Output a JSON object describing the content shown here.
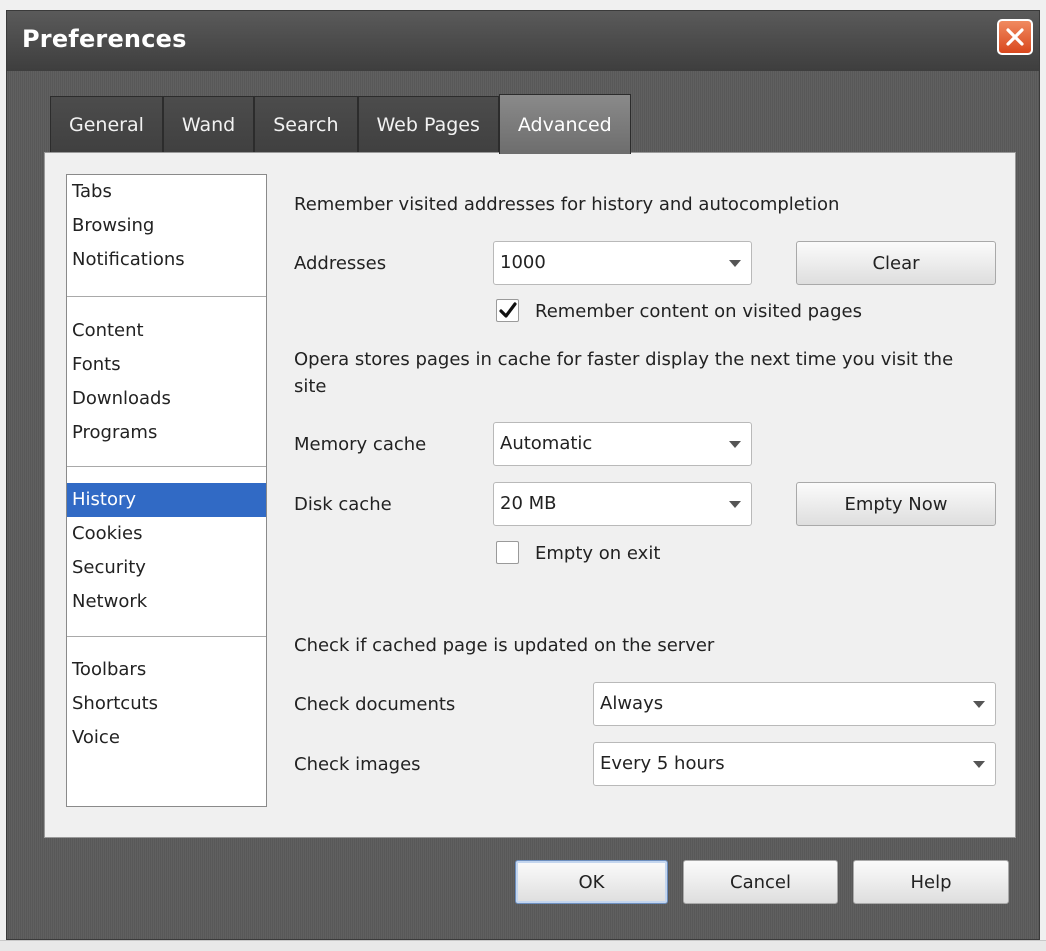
{
  "window": {
    "title": "Preferences"
  },
  "tabs": [
    {
      "label": "General"
    },
    {
      "label": "Wand"
    },
    {
      "label": "Search"
    },
    {
      "label": "Web Pages"
    },
    {
      "label": "Advanced",
      "active": true
    }
  ],
  "sidebar": {
    "groups": [
      [
        "Tabs",
        "Browsing",
        "Notifications"
      ],
      [
        "Content",
        "Fonts",
        "Downloads",
        "Programs"
      ],
      [
        "History",
        "Cookies",
        "Security",
        "Network"
      ],
      [
        "Toolbars",
        "Shortcuts",
        "Voice"
      ]
    ],
    "selected": "History"
  },
  "history": {
    "remember_heading": "Remember visited addresses for history and autocompletion",
    "addresses_label": "Addresses",
    "addresses_value": "1000",
    "clear_label": "Clear",
    "remember_content_label": "Remember content on visited pages",
    "remember_content_checked": true,
    "cache_heading": "Opera stores pages in cache for faster display the next time you visit the site",
    "memory_cache_label": "Memory cache",
    "memory_cache_value": "Automatic",
    "disk_cache_label": "Disk cache",
    "disk_cache_value": "20 MB",
    "empty_now_label": "Empty Now",
    "empty_on_exit_label": "Empty on exit",
    "empty_on_exit_checked": false,
    "check_heading": "Check if cached page is updated on the server",
    "check_documents_label": "Check documents",
    "check_documents_value": "Always",
    "check_images_label": "Check images",
    "check_images_value": "Every 5 hours"
  },
  "footer": {
    "ok_label": "OK",
    "cancel_label": "Cancel",
    "help_label": "Help"
  },
  "colors": {
    "selection": "#316ac5",
    "close": "#d9481e"
  }
}
